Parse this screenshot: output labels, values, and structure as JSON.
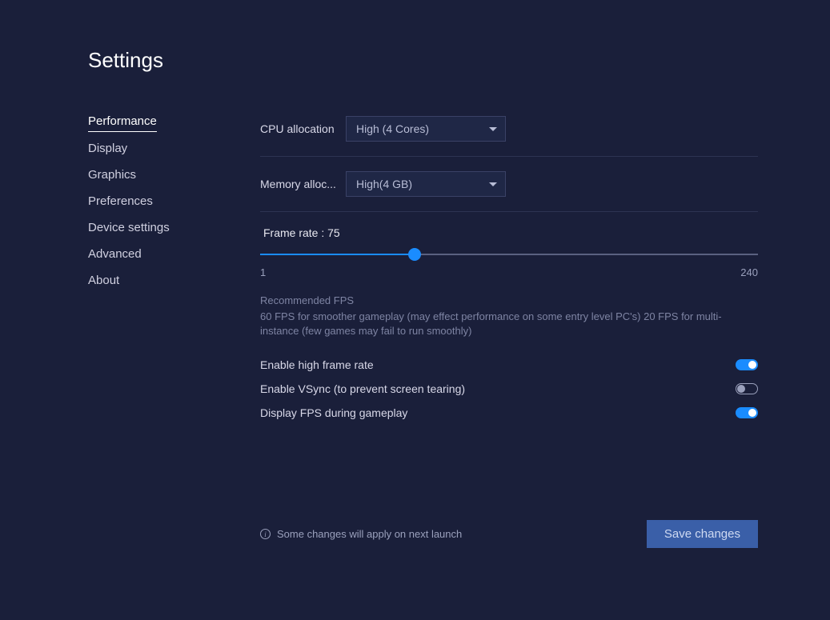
{
  "title": "Settings",
  "sidebar": {
    "items": [
      {
        "label": "Performance",
        "active": true
      },
      {
        "label": "Display"
      },
      {
        "label": "Graphics"
      },
      {
        "label": "Preferences"
      },
      {
        "label": "Device settings"
      },
      {
        "label": "Advanced"
      },
      {
        "label": "About"
      }
    ]
  },
  "cpu": {
    "label": "CPU allocation",
    "value": "High (4 Cores)"
  },
  "memory": {
    "label": "Memory alloc...",
    "value": "High(4 GB)"
  },
  "framerate": {
    "label_prefix": "Frame rate : ",
    "value": 75,
    "min": 1,
    "max": 240,
    "min_label": "1",
    "max_label": "240"
  },
  "hint": {
    "title": "Recommended FPS",
    "text": "60 FPS for smoother gameplay (may effect performance on some entry level PC's) 20 FPS for multi-instance (few games may fail to run smoothly)"
  },
  "toggles": {
    "high_fps": {
      "label": "Enable high frame rate",
      "on": true
    },
    "vsync": {
      "label": "Enable VSync (to prevent screen tearing)",
      "on": false
    },
    "show_fps": {
      "label": "Display FPS during gameplay",
      "on": true
    }
  },
  "footer": {
    "note": "Some changes will apply on next launch",
    "save": "Save changes"
  }
}
